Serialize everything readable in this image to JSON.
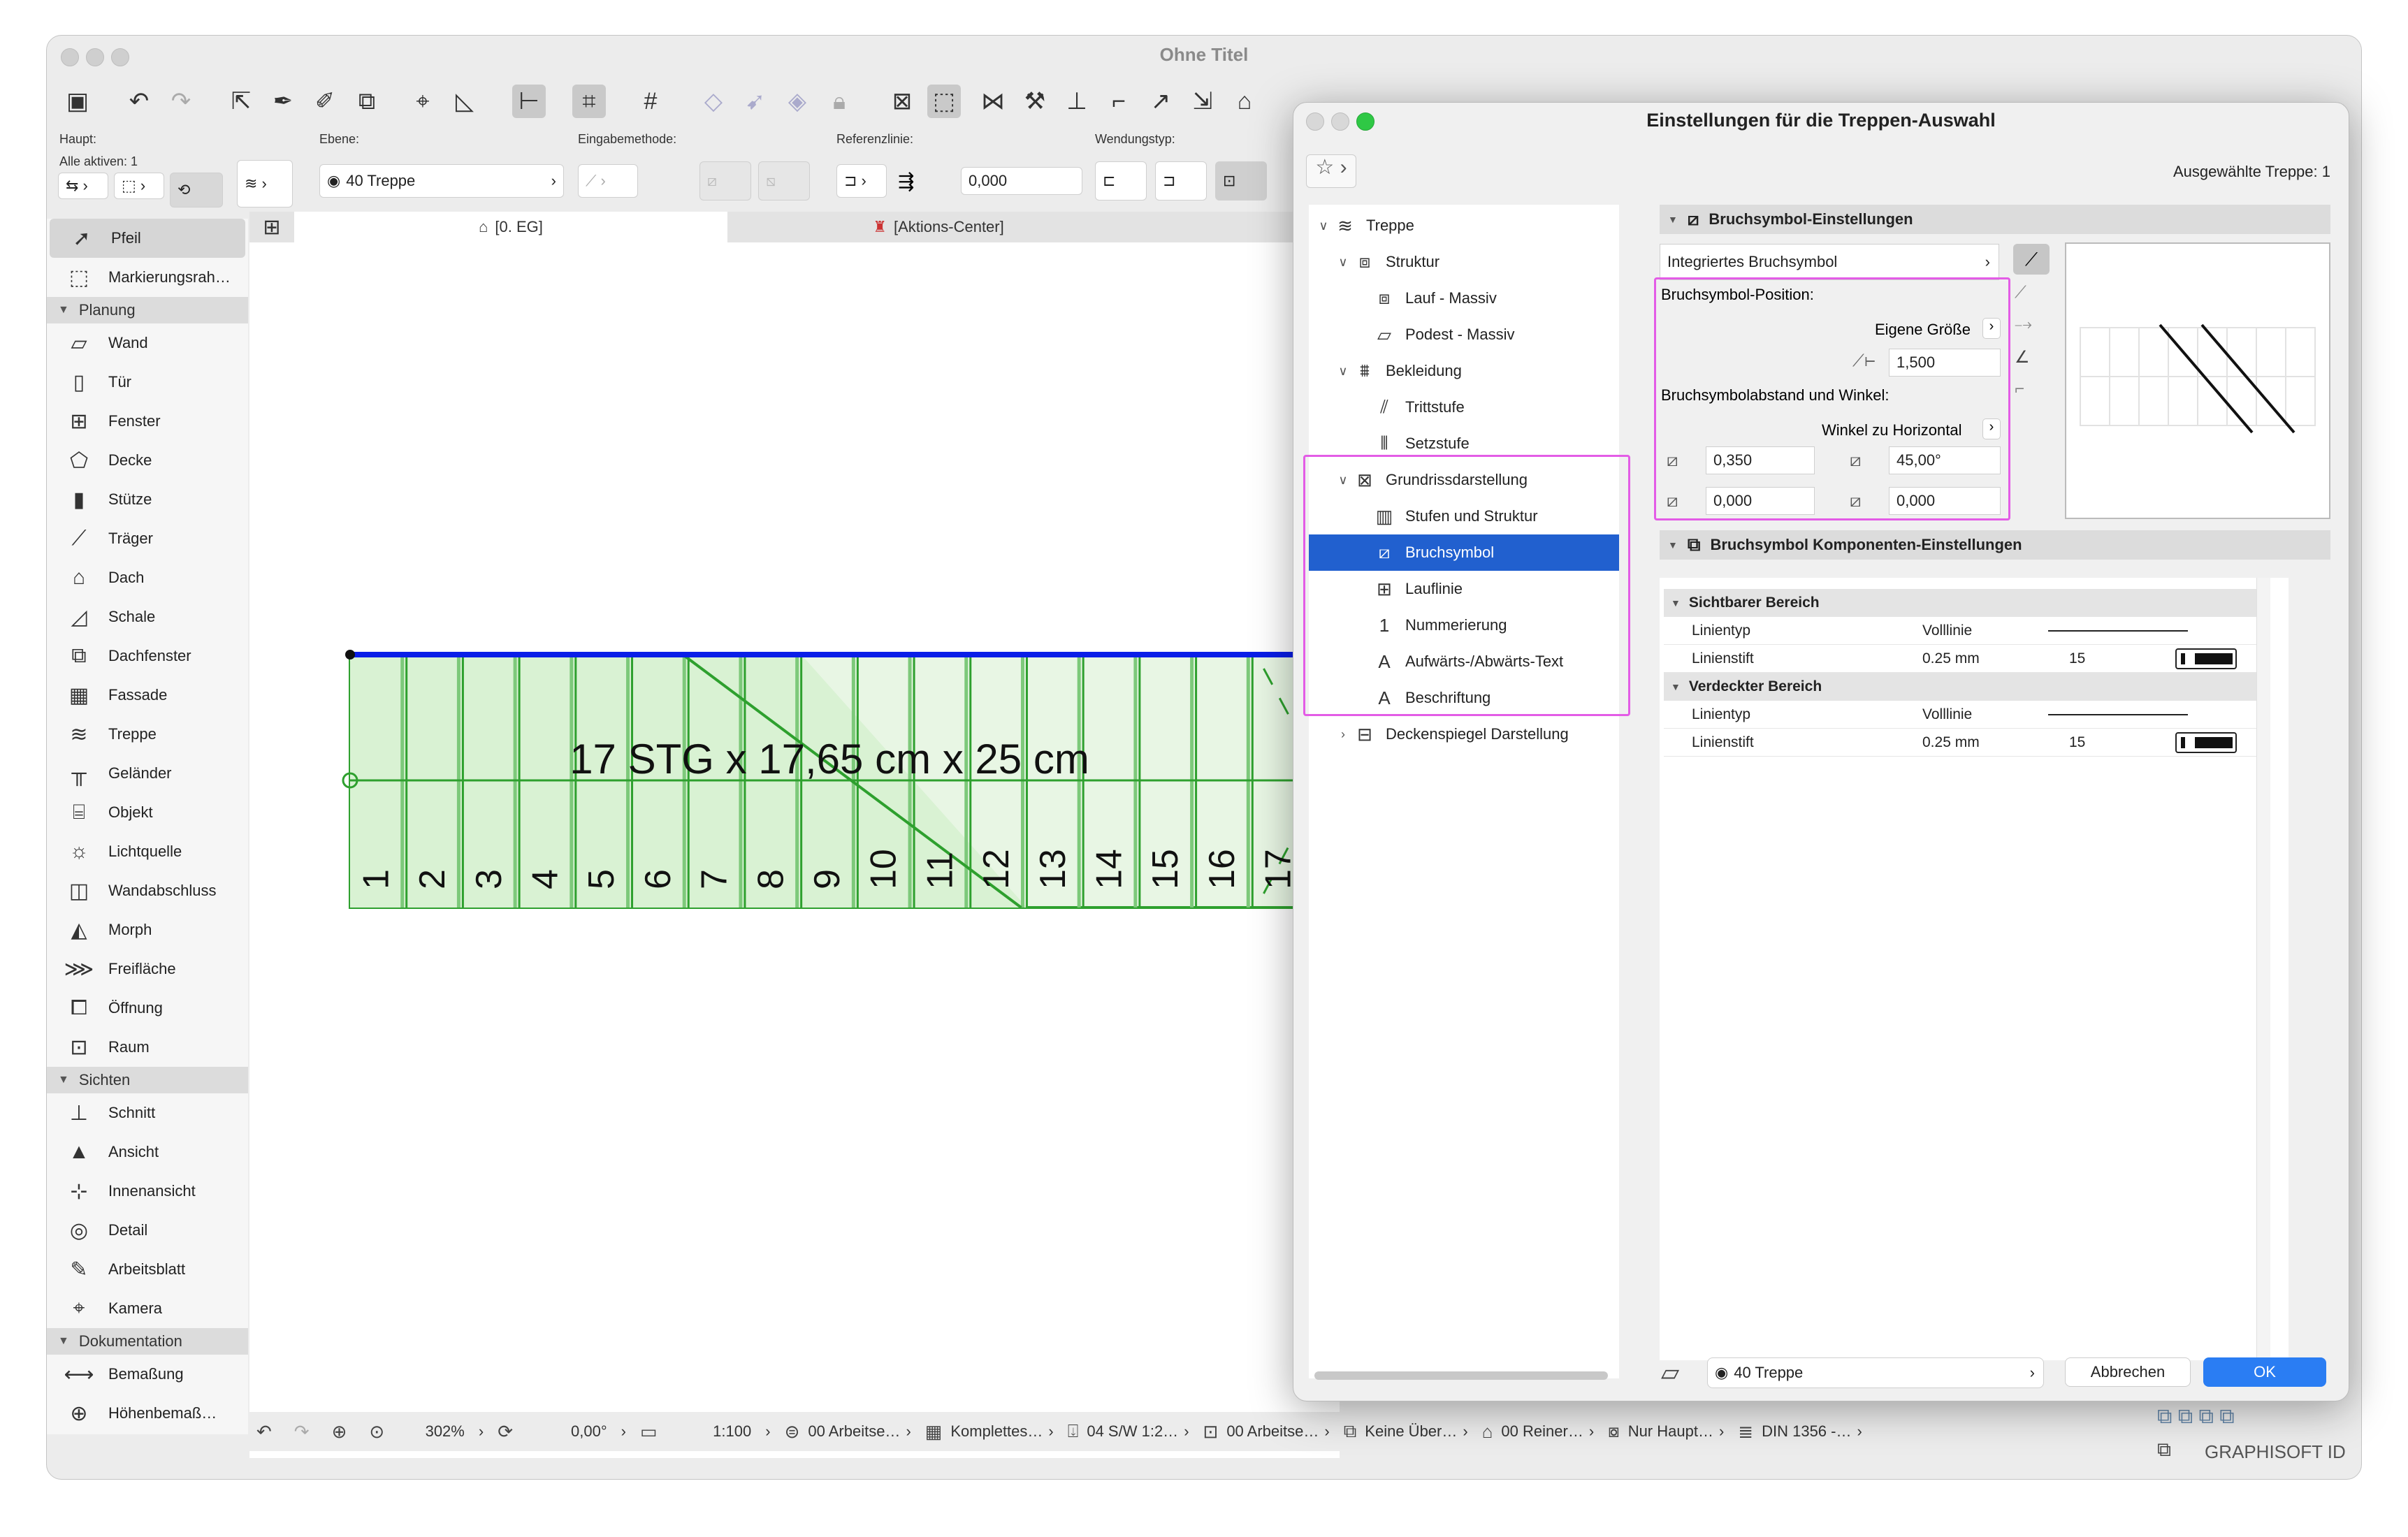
{
  "window": {
    "title": "Ohne Titel"
  },
  "infobox": {
    "haupt_label": "Haupt:",
    "alle_aktiven": "Alle aktiven: 1",
    "ebene_label": "Ebene:",
    "ebene_value": "40 Treppe",
    "eingabemethode_label": "Eingabemethode:",
    "referenzlinie_label": "Referenzlinie:",
    "referenz_value": "0,000",
    "wendungstyp_label": "Wendungstyp:"
  },
  "tabs": [
    {
      "label": "[0. EG]"
    },
    {
      "label": "[Aktions-Center]"
    }
  ],
  "toolbox": {
    "top_items": [
      {
        "label": "Pfeil",
        "icon": "arrow-icon",
        "glyph": "➚"
      },
      {
        "label": "Markierungsrah…",
        "icon": "marquee-icon",
        "glyph": "⬚"
      }
    ],
    "groups": [
      {
        "name": "Planung",
        "items": [
          {
            "label": "Wand",
            "glyph": "▱"
          },
          {
            "label": "Tür",
            "glyph": "▯"
          },
          {
            "label": "Fenster",
            "glyph": "⊞"
          },
          {
            "label": "Decke",
            "glyph": "⬠"
          },
          {
            "label": "Stütze",
            "glyph": "▮"
          },
          {
            "label": "Träger",
            "glyph": "⟋"
          },
          {
            "label": "Dach",
            "glyph": "⌂"
          },
          {
            "label": "Schale",
            "glyph": "◿"
          },
          {
            "label": "Dachfenster",
            "glyph": "⧉"
          },
          {
            "label": "Fassade",
            "glyph": "▦"
          },
          {
            "label": "Treppe",
            "glyph": "≋"
          },
          {
            "label": "Geländer",
            "glyph": "╥"
          },
          {
            "label": "Objekt",
            "glyph": "⌸"
          },
          {
            "label": "Lichtquelle",
            "glyph": "☼"
          },
          {
            "label": "Wandabschluss",
            "glyph": "◫"
          },
          {
            "label": "Morph",
            "glyph": "◭"
          },
          {
            "label": "Freifläche",
            "glyph": "⋙"
          },
          {
            "label": "Öffnung",
            "glyph": "⧠"
          },
          {
            "label": "Raum",
            "glyph": "⊡"
          }
        ]
      },
      {
        "name": "Sichten",
        "items": [
          {
            "label": "Schnitt",
            "glyph": "⊥"
          },
          {
            "label": "Ansicht",
            "glyph": "▲"
          },
          {
            "label": "Innenansicht",
            "glyph": "⊹"
          },
          {
            "label": "Detail",
            "glyph": "◎"
          },
          {
            "label": "Arbeitsblatt",
            "glyph": "✎"
          },
          {
            "label": "Kamera",
            "glyph": "⌖"
          }
        ]
      },
      {
        "name": "Dokumentation",
        "items": [
          {
            "label": "Bemaßung",
            "glyph": "⟷"
          },
          {
            "label": "Höhenbemaß…",
            "glyph": "⊕"
          }
        ]
      }
    ]
  },
  "stair": {
    "label": "17 STG x 17,65 cm x 25 cm",
    "steps": [
      "1",
      "2",
      "3",
      "4",
      "5",
      "6",
      "7",
      "8",
      "9",
      "10",
      "11",
      "12",
      "13",
      "14",
      "15",
      "16",
      "17"
    ]
  },
  "statusbar": {
    "zoom": "302%",
    "angle": "0,00°",
    "scale": "1:100",
    "items": [
      "00 Arbeitse…",
      "Komplettes…",
      "04 S/W 1:2…",
      "00 Arbeitse…",
      "Keine Über…",
      "00 Reiner…",
      "Nur Haupt…",
      "DIN 1356 -…"
    ],
    "graphisoft": "GRAPHISOFT ID"
  },
  "dialog": {
    "title": "Einstellungen für die Treppen-Auswahl",
    "selected": "Ausgewählte Treppe: 1",
    "tree": [
      {
        "label": "Treppe",
        "level": 0,
        "chev": "∨",
        "glyph": "≋"
      },
      {
        "label": "Struktur",
        "level": 1,
        "chev": "∨",
        "glyph": "⧈"
      },
      {
        "label": "Lauf - Massiv",
        "level": 2,
        "chev": "",
        "glyph": "⧈"
      },
      {
        "label": "Podest - Massiv",
        "level": 2,
        "chev": "",
        "glyph": "▱"
      },
      {
        "label": "Bekleidung",
        "level": 1,
        "chev": "∨",
        "glyph": "⩩"
      },
      {
        "label": "Trittstufe",
        "level": 2,
        "chev": "",
        "glyph": "⫽"
      },
      {
        "label": "Setzstufe",
        "level": 2,
        "chev": "",
        "glyph": "⦀"
      },
      {
        "label": "Grundrissdarstellung",
        "level": 1,
        "chev": "∨",
        "glyph": "⊠"
      },
      {
        "label": "Stufen und Struktur",
        "level": 2,
        "chev": "",
        "glyph": "▥"
      },
      {
        "label": "Bruchsymbol",
        "level": 2,
        "chev": "",
        "glyph": "⧄"
      },
      {
        "label": "Lauflinie",
        "level": 2,
        "chev": "",
        "glyph": "⊞"
      },
      {
        "label": "Nummerierung",
        "level": 2,
        "chev": "",
        "glyph": "1"
      },
      {
        "label": "Aufwärts-/Abwärts-Text",
        "level": 2,
        "chev": "",
        "glyph": "A"
      },
      {
        "label": "Beschriftung",
        "level": 2,
        "chev": "",
        "glyph": "A"
      },
      {
        "label": "Deckenspiegel Darstellung",
        "level": 1,
        "chev": "›",
        "glyph": "⊟"
      }
    ],
    "section1": "Bruchsymbol-Einstellungen",
    "type_select": "Integriertes Bruchsymbol",
    "position_label": "Bruchsymbol-Position:",
    "eigene_groesse": "Eigene Größe",
    "size_value": "1,500",
    "abstand_label": "Bruchsymbolabstand und Winkel:",
    "winkel_label": "Winkel zu Horizontal",
    "val_a": "0,350",
    "val_b": "45,00°",
    "val_c": "0,000",
    "val_d": "0,000",
    "section2": "Bruchsymbol Komponenten-Einstellungen",
    "table": {
      "visible": "Sichtbarer Bereich",
      "hidden": "Verdeckter Bereich",
      "rows_visible": [
        {
          "name": "Linientyp",
          "value": "Volllinie",
          "num": ""
        },
        {
          "name": "Linienstift",
          "value": "0.25 mm",
          "num": "15"
        }
      ],
      "rows_hidden": [
        {
          "name": "Linientyp",
          "value": "Volllinie",
          "num": ""
        },
        {
          "name": "Linienstift",
          "value": "0.25 mm",
          "num": "15"
        }
      ]
    },
    "layer": "40 Treppe",
    "cancel": "Abbrechen",
    "ok": "OK"
  }
}
